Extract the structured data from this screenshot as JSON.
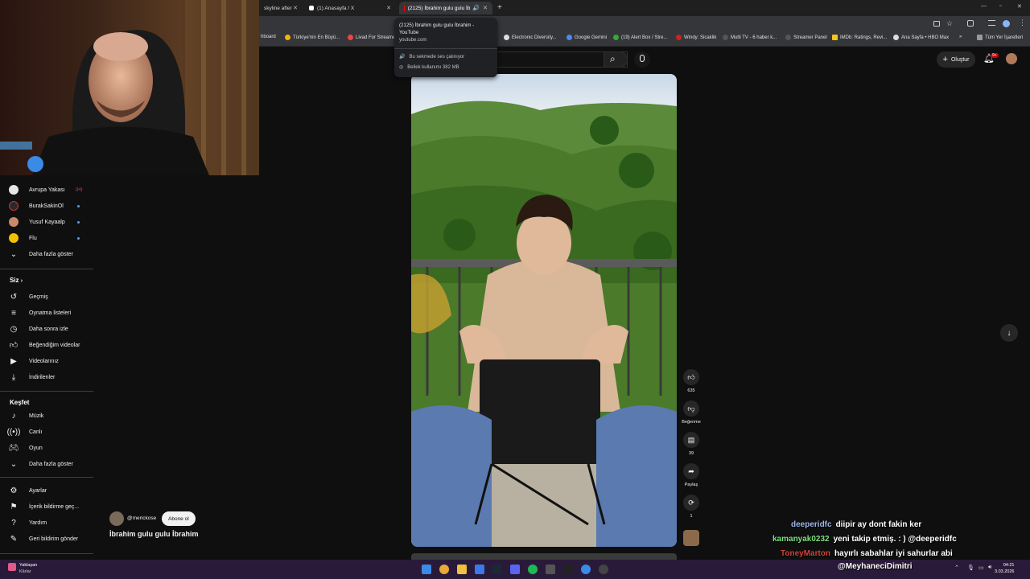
{
  "browser": {
    "tabs": [
      {
        "label": "skyline after",
        "active": false
      },
      {
        "label": "(1) Anasayfa / X",
        "active": false
      },
      {
        "label": "(2125) İbrahim gulu gulu İb",
        "active": true
      }
    ],
    "bookmarks": [
      "hboard",
      "Türkiye'nin En Büyü...",
      "Livad For Streamers",
      "Electronic Diversity...",
      "Google Gemini",
      "(19) Alert Box / Stre...",
      "Windy: Sicaklik",
      "Multi TV - 6 haber k...",
      "Streamer Panel",
      "IMDb: Ratings, Revi...",
      "Ana Sayfa • HBO Max",
      "»",
      "Tüm Yer İşaretleri"
    ]
  },
  "tooltip": {
    "title": "(2125) İbrahim gulu gulu İbrahim - YouTube",
    "url": "youtube.com",
    "audio": "Bu sekmede ses çalınıyor",
    "memory": "Bellek kullanımı 382 MB"
  },
  "header": {
    "create_label": "Oluştur",
    "notif_count": "9+"
  },
  "sidebar": {
    "subscriptions": [
      {
        "label": "Avrupa Yakası",
        "color": "#e6e6e6",
        "badge": "live"
      },
      {
        "label": "BurakSakinOl",
        "color": "#2a2a2a",
        "badge": "dot"
      },
      {
        "label": "Yusuf Kayaalp",
        "color": "#c98a6a",
        "badge": "dot"
      },
      {
        "label": "Flu",
        "color": "#f2c200",
        "badge": "dot"
      }
    ],
    "show_more": "Daha fazla göster",
    "you_title": "Siz",
    "you_items": [
      {
        "label": "Geçmiş",
        "icon": "history-icon"
      },
      {
        "label": "Oynatma listeleri",
        "icon": "playlists-icon"
      },
      {
        "label": "Daha sonra izle",
        "icon": "watch-later-icon"
      },
      {
        "label": "Beğendiğim videolar",
        "icon": "liked-icon"
      },
      {
        "label": "Videolarınız",
        "icon": "your-videos-icon"
      },
      {
        "label": "İndirilenler",
        "icon": "downloads-icon"
      }
    ],
    "explore_title": "Keşfet",
    "explore_items": [
      {
        "label": "Müzik",
        "icon": "music-icon"
      },
      {
        "label": "Canlı",
        "icon": "live-icon"
      },
      {
        "label": "Oyun",
        "icon": "gaming-icon"
      }
    ],
    "explore_more": "Daha fazla göster",
    "settings_items": [
      {
        "label": "Ayarlar",
        "icon": "settings-icon"
      },
      {
        "label": "İçerik bildirme geç...",
        "icon": "flag-icon"
      },
      {
        "label": "Yardım",
        "icon": "help-icon"
      },
      {
        "label": "Geri bildirim gönder",
        "icon": "feedback-icon"
      }
    ]
  },
  "short": {
    "channel": "@merickose",
    "subscribe_label": "Abone ol",
    "title": "İbrahim gulu gulu İbrahim",
    "likes": "635",
    "dislike_label": "Beğenme",
    "comments": "39",
    "share_label": "Paylaş",
    "remix_count": "1"
  },
  "chat": [
    {
      "user": "deeperidfc",
      "msg": "diipir ay dont fakin ker",
      "color": "#9fb8e8"
    },
    {
      "user": "kamanyak0232",
      "msg": "yeni takip etmiş. : ) @deeperidfc",
      "color": "#7fe07f"
    },
    {
      "user": "ToneyMarton",
      "msg": "hayırlı sabahlar iyi sahurlar abi",
      "color": "#d0423a"
    },
    {
      "user": "",
      "msg": "@MeyhaneciDimitri",
      "color": "#ffffff"
    }
  ],
  "taskbar": {
    "weather_title": "Yaklaşan",
    "weather_sub": "Kârlar",
    "time": "04:21",
    "date": "3.03.2026"
  }
}
